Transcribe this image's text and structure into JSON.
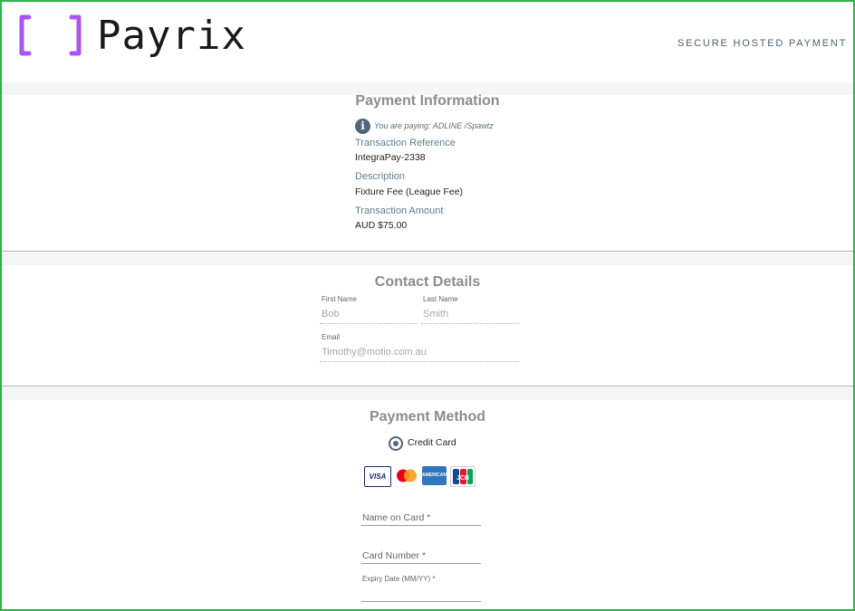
{
  "header": {
    "brand": "Payrix",
    "secure_label": "SECURE HOSTED PAYMENT",
    "brand_color": "#a855f7"
  },
  "payment_info": {
    "title": "Payment Information",
    "paying_text": "You are paying: ADLINE /Spawtz",
    "info_icon": "info-icon",
    "reference_label": "Transaction Reference",
    "reference_value": "IntegraPay-2338",
    "description_label": "Description",
    "description_value": "Fixture Fee (League Fee)",
    "amount_label": "Transaction Amount",
    "amount_value": "AUD $75.00"
  },
  "contact": {
    "title": "Contact Details",
    "first_name_label": "First Name",
    "first_name_value": "Bob",
    "last_name_label": "Last Name",
    "last_name_value": "Smith",
    "email_label": "Email",
    "email_value": "Timothy@motio.com.au"
  },
  "payment_method": {
    "title": "Payment Method",
    "option_label": "Credit Card",
    "card_icons": [
      "visa-icon",
      "mastercard-icon",
      "amex-icon",
      "jcb-icon"
    ],
    "visa_text": "VISA",
    "amex_text": "AMERICAN EXPRESS",
    "jcb_text": "JCB",
    "name_placeholder": "Name on Card *",
    "number_placeholder": "Card Number *",
    "expiry_placeholder": "Expiry Date (MM/YY) *"
  },
  "colors": {
    "frame": "#2db34a",
    "accent": "#506679",
    "label": "#5e7d92"
  }
}
